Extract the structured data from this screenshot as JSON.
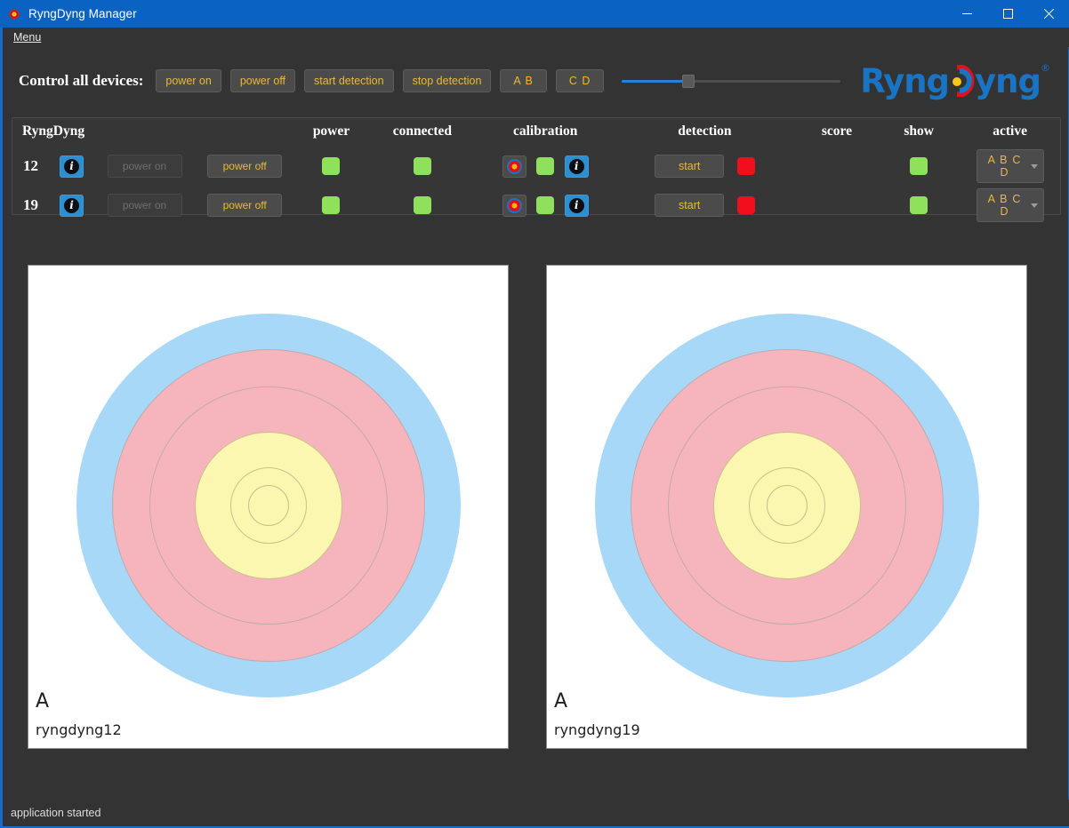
{
  "window": {
    "title": "RyngDyng Manager",
    "icon": "ryngdyng-logo-icon",
    "minimize_label": "—",
    "maximize_label": "□",
    "close_label": "✕"
  },
  "menubar": {
    "items": [
      {
        "label": "Menu",
        "mnemonic": "M"
      }
    ]
  },
  "controlbar": {
    "label": "Control all devices:",
    "buttons": [
      {
        "name": "power-on",
        "label": "power on"
      },
      {
        "name": "power-off",
        "label": "power off"
      },
      {
        "name": "start-detection",
        "label": "start detection"
      },
      {
        "name": "stop-detection",
        "label": "stop detection"
      },
      {
        "name": "ab",
        "label": "A B"
      },
      {
        "name": "cd",
        "label": "C D"
      }
    ],
    "slider": {
      "value": 30,
      "min": 0,
      "max": 100
    }
  },
  "logo": {
    "text_left": "Ryng",
    "text_right": "yng",
    "registered": "®",
    "color": "#1a74c4",
    "accent_arc": "#e0111b",
    "accent_dot": "#f5c518"
  },
  "device_table": {
    "headers": {
      "id": "RyngDyng",
      "power": "power",
      "connected": "connected",
      "calibration": "calibration",
      "detection": "detection",
      "score": "score",
      "show": "show",
      "active": "active"
    },
    "rows": [
      {
        "id": "12",
        "info_label": "i",
        "power_on_label": "power on",
        "power_on_enabled": false,
        "power_off_label": "power off",
        "power_led": "green",
        "connected_led": "green",
        "calibration_icon": "target-icon",
        "calibration_led": "green",
        "calibration_info_label": "i",
        "detection_start_label": "start",
        "detection_led": "red",
        "score": "",
        "show_led": "green",
        "active_value": "A B C D"
      },
      {
        "id": "19",
        "info_label": "i",
        "power_on_label": "power on",
        "power_on_enabled": false,
        "power_off_label": "power off",
        "power_led": "green",
        "connected_led": "green",
        "calibration_icon": "target-icon",
        "calibration_led": "green",
        "calibration_info_label": "i",
        "detection_start_label": "start",
        "detection_led": "red",
        "score": "",
        "show_led": "green",
        "active_value": "A B C D"
      }
    ]
  },
  "target_panels": [
    {
      "letter": "A",
      "device_name": "ryngdyng12"
    },
    {
      "letter": "A",
      "device_name": "ryngdyng19"
    }
  ],
  "target_face": {
    "colors": {
      "blue": "#a8d8f8",
      "pink": "#f6b5bd",
      "yellow": "#fbf6b0",
      "line": "#c4a8ab"
    }
  },
  "statusbar": {
    "text": "application started"
  }
}
